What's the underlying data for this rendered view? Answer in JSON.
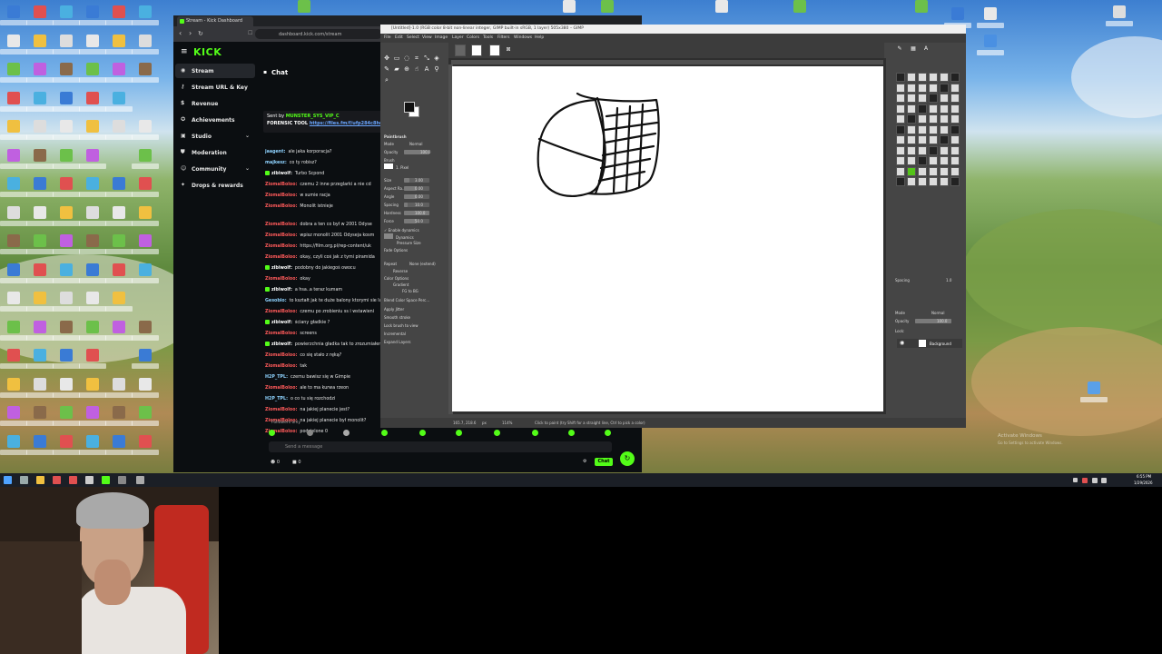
{
  "browser": {
    "tab_title": "Stream - Kick Dashboard",
    "url": "dashboard.kick.com/stream",
    "logo": "KICK"
  },
  "sidebar": {
    "items": [
      {
        "label": "Stream",
        "icon": "broadcast-icon",
        "active": true
      },
      {
        "label": "Stream URL & Key",
        "icon": "key-icon"
      },
      {
        "label": "Revenue",
        "icon": "dollar-icon"
      },
      {
        "label": "Achievements",
        "icon": "trophy-icon"
      },
      {
        "label": "Studio",
        "icon": "studio-icon",
        "expandable": true
      },
      {
        "label": "Moderation",
        "icon": "shield-icon"
      },
      {
        "label": "Community",
        "icon": "community-icon",
        "expandable": true
      },
      {
        "label": "Drops & rewards",
        "icon": "gift-icon"
      }
    ]
  },
  "chat": {
    "title": "Chat",
    "pinned_sender": "Sent by",
    "pinned_user": "MUNSTER_SYS_VIP_C",
    "pinned_text": "FORENSIC TOOL",
    "pinned_link": "https://files.fm/f/ufp284c8hn",
    "messages": [
      {
        "user": "jaagent:",
        "text": "ale jaka korporacja?"
      },
      {
        "user": "majkesz:",
        "text": "co ty robisz?"
      },
      {
        "user": "zibiwolf:",
        "text": "Turbo Scpond"
      },
      {
        "user": "ZiomalBoloo:",
        "text": "czemu 2 inne przeglarki a nie cd"
      },
      {
        "user": "ZiomalBoloo:",
        "text": "w sumie racja"
      },
      {
        "user": "ZiomalBoloo:",
        "text": "Monolit istnieje"
      },
      {
        "user": "ZiomalBoloo:",
        "text": "dobra a ten co był w 2001 Odyse"
      },
      {
        "user": "ZiomalBoloo:",
        "text": "wpisz monolit 2001 Odyseja kosm"
      },
      {
        "user": "ZiomalBoloo:",
        "text": "https://film.org.pl/rep-content/uk"
      },
      {
        "user": "ZiomalBoloo:",
        "text": "okay, czyli coś jak z tymi piramida"
      },
      {
        "user": "zibiwolf:",
        "text": "podobny do jakiegoś owocu"
      },
      {
        "user": "ZiomalBoloo:",
        "text": "okay"
      },
      {
        "user": "zibiwolf:",
        "text": "a hsa..a teraz kumam"
      },
      {
        "user": "Gesobio:",
        "text": "to kształt jak te duże balony ktorymi sie lata"
      },
      {
        "user": "ZiomalBoloo:",
        "text": "czemu po zrobieniu ss i wstawieni"
      },
      {
        "user": "zibiwolf:",
        "text": "ściany gładkie ?"
      },
      {
        "user": "ZiomalBoloo:",
        "text": "screens"
      },
      {
        "user": "zibiwolf:",
        "text": "powierzchnia gładka tak to zrozumiałem"
      },
      {
        "user": "ZiomalBoloo:",
        "text": "co się stało z ręką?"
      },
      {
        "user": "ZiomalBoloo:",
        "text": "tak"
      },
      {
        "user": "H2P_TPL:",
        "text": "czemu bawisz się w Gimpie"
      },
      {
        "user": "ZiomalBoloo:",
        "text": "ale to ma kurwa rzeon"
      },
      {
        "user": "H2P_TPL:",
        "text": "o co tu się rozchodzi"
      },
      {
        "user": "ZiomalBoloo:",
        "text": "na jakiej planecie jest?"
      },
      {
        "user": "ZiomalBoloo:",
        "text": "na jakiej planecie był monolit?"
      },
      {
        "user": "ZiomalBoloo:",
        "text": "podzielone 0"
      }
    ],
    "followers_only": "Followers only",
    "send_placeholder": "Send a message",
    "chat_button": "Chat",
    "viewer_count": "0",
    "sub_count": "0"
  },
  "gimp": {
    "title": "[Untitled]-1.0 (RGB color 8-bit non-linear integer, GIMP built-in sRGB, 1 layer) 505x380 – GIMP",
    "menu": [
      "File",
      "Edit",
      "Select",
      "View",
      "Image",
      "Layer",
      "Colors",
      "Tools",
      "Filters",
      "Windows",
      "Help"
    ],
    "tool_options": {
      "heading": "Paintbrush",
      "mode_label": "Mode",
      "mode_value": "Normal",
      "opacity_label": "Opacity",
      "opacity_value": "100.0",
      "brush_label": "Brush",
      "brush_value": "1. Pixel",
      "size_label": "Size",
      "size_value": "3.00",
      "aspect_label": "Aspect Ra...",
      "aspect_value": "0.00",
      "angle_label": "Angle",
      "angle_value": "0.00",
      "spacing_label": "Spacing",
      "spacing_value": "10.0",
      "hardness_label": "Hardness",
      "hardness_value": "100.0",
      "force_label": "Force",
      "force_value": "50.0",
      "dynamics_check": "Enable dynamics",
      "dynamics_label": "Dynamics",
      "dynamics_value": "Pressure Size",
      "fade_label": "Fade Options",
      "repeat_label": "Repeat",
      "repeat_value": "None (extend)",
      "reverse_label": "Reverse",
      "color_label": "Color Options",
      "gradient_label": "Gradient",
      "gradient_value": "FG to BG",
      "blend_label": "Blend Color Space Perc...",
      "jitter": "Apply Jitter",
      "smooth": "Smooth stroke",
      "lock": "Lock brush to view",
      "incremental": "Incremental",
      "expand": "Expand Layers"
    },
    "status": {
      "coords": "165.7, 218.6",
      "unit": "px",
      "zoom": "114%",
      "hint": "Click to paint (try Shift for a straight line, Ctrl to pick a color)"
    },
    "dock": {
      "brush_tab": "Pencil",
      "spacing_label": "Spacing",
      "spacing_value": "1.0",
      "mode_label": "Mode",
      "mode_value": "Normal",
      "opacity_label": "Opacity",
      "opacity_value": "100.0",
      "lock_label": "Lock:",
      "layer_name": "Background"
    }
  },
  "taskbar": {
    "time": "6:55 PM",
    "date": "1/29/2026"
  },
  "watermark": {
    "line1": "Activate Windows",
    "line2": "Go to Settings to activate Windows."
  }
}
